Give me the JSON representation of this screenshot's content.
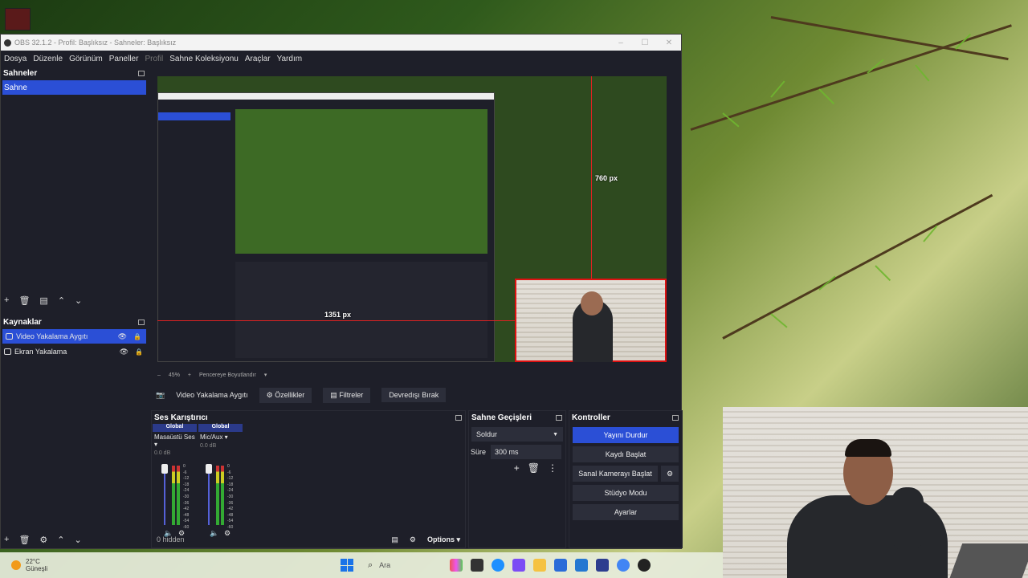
{
  "window": {
    "title": "OBS 32.1.2 - Profil: Başlıksız - Sahneler: Başlıksız",
    "controls": [
      "–",
      "☐",
      "✕"
    ]
  },
  "menu": [
    "Dosya",
    "Düzenle",
    "Görünüm",
    "Paneller",
    "Profil",
    "Sahne Koleksiyonu",
    "Araçlar",
    "Yardım"
  ],
  "scenes": {
    "title": "Sahneler",
    "items": [
      "Sahne"
    ]
  },
  "sources": {
    "title": "Kaynaklar",
    "items": [
      "Video Yakalama Aygıtı",
      "Ekran Yakalama"
    ]
  },
  "preview": {
    "vertical_guide_label": "760 px",
    "horizontal_guide_label": "1351 px"
  },
  "zoom": {
    "value": "45%",
    "fit_label": "Pencereye Boyutlandır"
  },
  "source_toolbar": {
    "source_name": "Video Yakalama Aygıtı",
    "properties": "Özellikler",
    "filters": "Filtreler",
    "deactivate": "Devredışı Bırak"
  },
  "mixer": {
    "title": "Ses Karıştırıcı",
    "channels": [
      {
        "global": "Global",
        "name": "Masaüstü Ses",
        "db": "0.0 dB"
      },
      {
        "global": "Global",
        "name": "Mic/Aux",
        "db": "0.0 dB"
      }
    ],
    "scale": [
      "0",
      "-6",
      "-12",
      "-18",
      "-24",
      "-30",
      "-36",
      "-42",
      "-48",
      "-54",
      "-60"
    ],
    "hidden": "0 hidden",
    "options": "Options"
  },
  "transitions": {
    "title": "Sahne Geçişleri",
    "selected": "Soldur",
    "duration_label": "Süre",
    "duration_value": "300 ms"
  },
  "controls": {
    "title": "Kontroller",
    "stop_stream": "Yayını Durdur",
    "start_recording": "Kaydı Başlat",
    "start_virtual_cam": "Sanal Kamerayı Başlat",
    "studio_mode": "Stüdyo Modu",
    "settings": "Ayarlar"
  },
  "taskbar": {
    "temperature": "22°C",
    "weather": "Güneşli",
    "search_placeholder": "Ara"
  },
  "colors": {
    "accent": "#2b4fd6",
    "panel": "#1e1f29",
    "guide": "#dd2222"
  }
}
